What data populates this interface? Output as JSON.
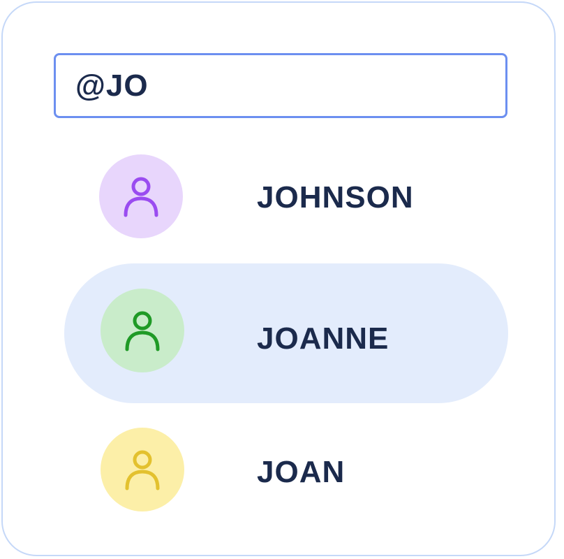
{
  "search": {
    "value": "@JO"
  },
  "suggestions": [
    {
      "name": "JOHNSON",
      "avatar_icon": "person-icon",
      "avatar_bg": "#e8d6fc",
      "icon_color": "#9a4cf0",
      "selected": false
    },
    {
      "name": "JOANNE",
      "avatar_icon": "person-icon",
      "avatar_bg": "#c9ecca",
      "icon_color": "#1f9a26",
      "selected": true
    },
    {
      "name": "JOAN",
      "avatar_icon": "person-icon",
      "avatar_bg": "#fcefa8",
      "icon_color": "#e3c12e",
      "selected": false
    }
  ],
  "colors": {
    "frame_border": "#c5d8f8",
    "input_border": "#6c8ff0",
    "selected_bg": "#e3ecfc",
    "text": "#1b2a4c"
  }
}
